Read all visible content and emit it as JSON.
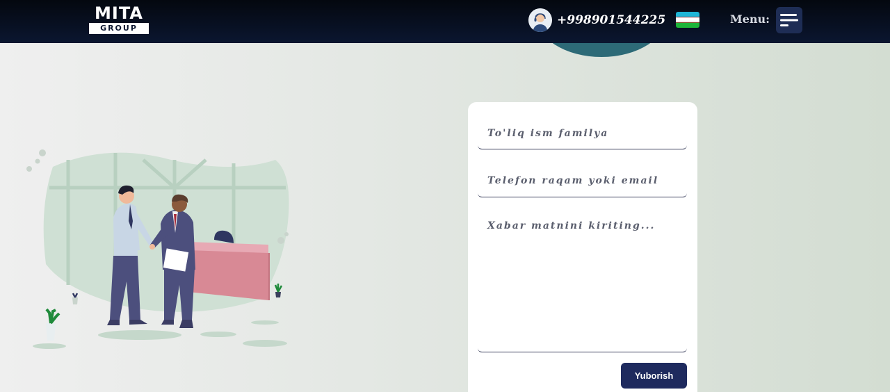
{
  "header": {
    "logo_top": "MITA",
    "logo_bottom": "GROUP",
    "phone": "+998901544225",
    "menu_label": "Menu:"
  },
  "form": {
    "name_placeholder": "To'liq ism familya",
    "contact_placeholder": "Telefon raqam yoki email",
    "message_placeholder": "Xabar matnini kiriting...",
    "submit_label": "Yuborish"
  },
  "icons": {
    "support_avatar": "support-agent-icon",
    "flag": "uzbekistan-flag-icon",
    "menu": "hamburger-menu-icon"
  },
  "colors": {
    "header_bg": "#0b1630",
    "accent_navy": "#1e2a5e",
    "teal": "#2d6a77"
  }
}
